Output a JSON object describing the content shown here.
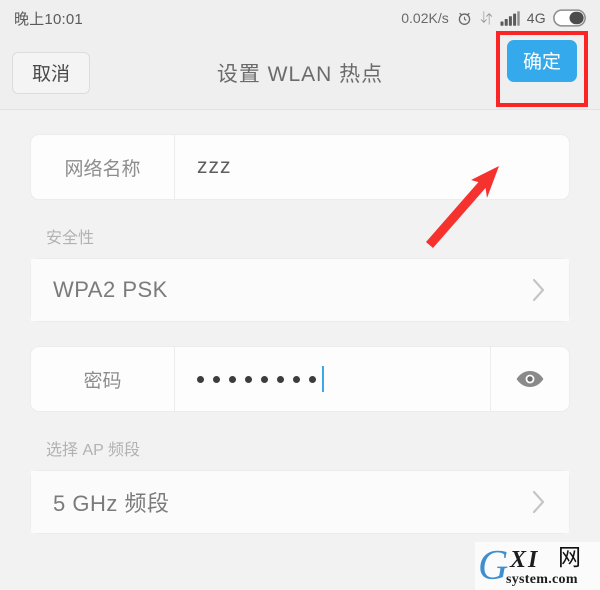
{
  "statusbar": {
    "time": "晚上10:01",
    "network_speed": "0.02K/s",
    "alarm_icon": "alarm-clock-icon",
    "data_transfer_icon": "data-transfer-arrows-icon",
    "signal_icon": "signal-bars-icon",
    "network_type": "4G",
    "battery_icon": "battery-icon"
  },
  "header": {
    "cancel_label": "取消",
    "title": "设置 WLAN 热点",
    "confirm_label": "确定",
    "highlight_color": "#fb2525",
    "confirm_color": "#34a9ec"
  },
  "form": {
    "network_name": {
      "label": "网络名称",
      "value": "zzz",
      "placeholder": "网络名称"
    },
    "security_section": {
      "label": "安全性",
      "value": "WPA2 PSK",
      "chevron_icon": "chevron-right-icon"
    },
    "password": {
      "label": "密码",
      "masked_value": "••••••••",
      "dot_count": 8,
      "caret_visible": true,
      "reveal_icon": "eye-icon"
    },
    "ap_band_section": {
      "label": "选择 AP 频段",
      "value": "5 GHz 频段",
      "chevron_icon": "chevron-right-icon"
    }
  },
  "annotation": {
    "arrow_icon": "red-arrow-up-right-icon",
    "arrow_color": "#f5322e"
  },
  "watermark": {
    "brand_g": "G",
    "brand_xi": "XI",
    "brand_wang": "网",
    "brand_domain": "system.com"
  }
}
